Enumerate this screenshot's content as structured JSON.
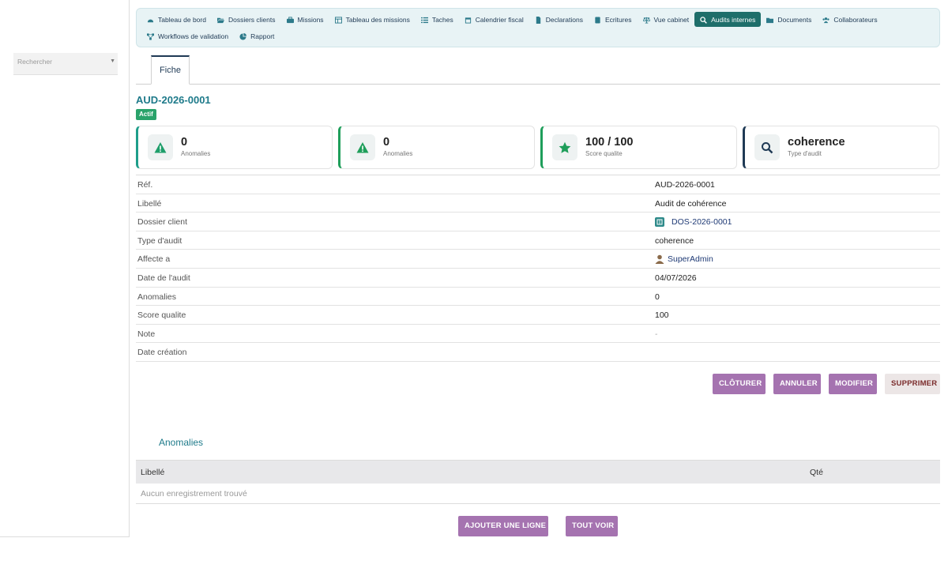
{
  "sidebar": {
    "search_placeholder": "Rechercher"
  },
  "menu": {
    "items": [
      {
        "label": "Tableau de bord",
        "icon": "dashboard-icon"
      },
      {
        "label": "Dossiers clients",
        "icon": "folder-open-icon"
      },
      {
        "label": "Missions",
        "icon": "briefcase-icon"
      },
      {
        "label": "Tableau des missions",
        "icon": "table-icon"
      },
      {
        "label": "Taches",
        "icon": "list-icon"
      },
      {
        "label": "Calendrier fiscal",
        "icon": "calendar-icon"
      },
      {
        "label": "Declarations",
        "icon": "file-icon"
      },
      {
        "label": "Ecritures",
        "icon": "book-icon"
      },
      {
        "label": "Vue cabinet",
        "icon": "scale-icon"
      },
      {
        "label": "Audits internes",
        "icon": "search-icon",
        "active": true
      },
      {
        "label": "Documents",
        "icon": "folder-icon"
      },
      {
        "label": "Collaborateurs",
        "icon": "users-icon"
      },
      {
        "label": "Workflows de validation",
        "icon": "sitemap-icon"
      },
      {
        "label": "Rapport",
        "icon": "chart-pie-icon"
      }
    ]
  },
  "tabs": {
    "fiche": "Fiche"
  },
  "record": {
    "ref": "AUD-2026-0001",
    "status": "Actif"
  },
  "cards": [
    {
      "value": "0",
      "label": "Anomalies",
      "icon": "warning-icon",
      "color": "#1e9e8a"
    },
    {
      "value": "0",
      "label": "Anomalies",
      "icon": "warning-icon",
      "color": "#1e9e5a"
    },
    {
      "value": "100 / 100",
      "label": "Score qualite",
      "icon": "star-icon",
      "color": "#1e9e5a"
    },
    {
      "value": "coherence",
      "label": "Type d'audit",
      "icon": "search-icon",
      "color": "#1f3a55"
    }
  ],
  "details": {
    "rows": [
      {
        "label": "Réf.",
        "value": "AUD-2026-0001"
      },
      {
        "label": "Libellé",
        "value": "Audit de cohérence"
      },
      {
        "label": "Dossier client",
        "value": "DOS-2026-0001"
      },
      {
        "label": "Type d'audit",
        "value": "coherence"
      },
      {
        "label": "Affecte a",
        "value": "SuperAdmin"
      },
      {
        "label": "Date de l'audit",
        "value": "04/07/2026"
      },
      {
        "label": "Anomalies",
        "value": "0"
      },
      {
        "label": "Score qualite",
        "value": "100"
      },
      {
        "label": "Note",
        "value": "-"
      },
      {
        "label": "Date création",
        "value": ""
      }
    ]
  },
  "actions": {
    "cloturer": "CLÔTURER",
    "annuler": "ANNULER",
    "modifier": "MODIFIER",
    "supprimer": "SUPPRIMER"
  },
  "anomalies": {
    "title": "Anomalies",
    "col_libelle": "Libellé",
    "col_qte": "Qté",
    "empty": "Aucun enregistrement trouvé",
    "add_line": "AJOUTER UNE LIGNE",
    "view_all": "TOUT VOIR"
  },
  "colors": {
    "accent": "#1e7a8a",
    "active_menu": "#1e6e6a",
    "button": "#a573b0",
    "badge": "#2aa36b"
  }
}
